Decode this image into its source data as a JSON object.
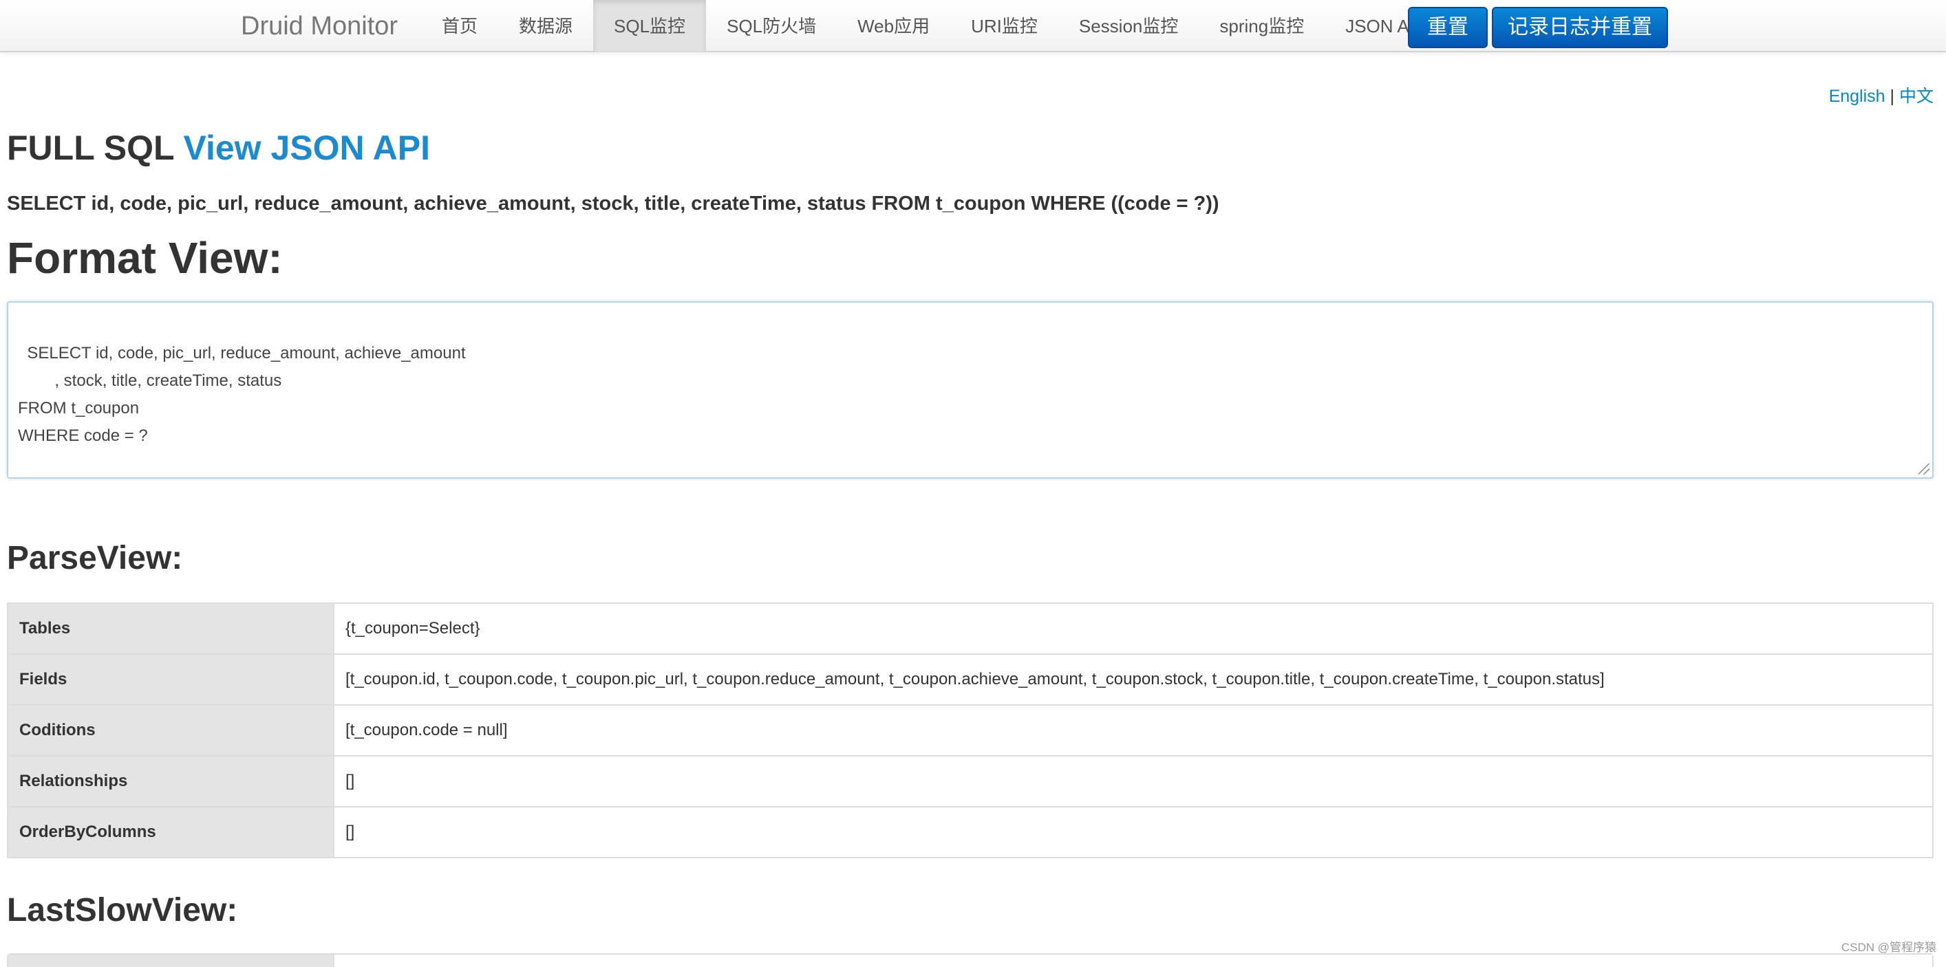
{
  "navbar": {
    "brand": "Druid Monitor",
    "items": [
      {
        "label": "首页"
      },
      {
        "label": "数据源"
      },
      {
        "label": "SQL监控"
      },
      {
        "label": "SQL防火墙"
      },
      {
        "label": "Web应用"
      },
      {
        "label": "URI监控"
      },
      {
        "label": "Session监控"
      },
      {
        "label": "spring监控"
      },
      {
        "label": "JSON API"
      }
    ],
    "active_item": "SQL监控",
    "reset_button": "重置",
    "log_reset_button": "记录日志并重置"
  },
  "lang": {
    "english": "English",
    "separator": "|",
    "chinese": "中文"
  },
  "full_sql": {
    "title": "FULL SQL",
    "link": "View JSON API",
    "sql": "SELECT id, code, pic_url, reduce_amount, achieve_amount, stock, title, createTime, status FROM t_coupon WHERE ((code = ?))"
  },
  "format_view": {
    "title": "Format View:",
    "text": "SELECT id, code, pic_url, reduce_amount, achieve_amount\n\t, stock, title, createTime, status\nFROM t_coupon\nWHERE code = ?"
  },
  "parse_view": {
    "title": "ParseView:",
    "rows": [
      {
        "key": "Tables",
        "value": "{t_coupon=Select}"
      },
      {
        "key": "Fields",
        "value": "[t_coupon.id, t_coupon.code, t_coupon.pic_url, t_coupon.reduce_amount, t_coupon.achieve_amount, t_coupon.stock, t_coupon.title, t_coupon.createTime, t_coupon.status]"
      },
      {
        "key": "Coditions",
        "value": "[t_coupon.code = null]"
      },
      {
        "key": "Relationships",
        "value": "[]"
      },
      {
        "key": "OrderByColumns",
        "value": "[]"
      }
    ]
  },
  "last_slow_view": {
    "title": "LastSlowView:"
  },
  "watermark": "CSDN @管程序猿",
  "colors": {
    "link": "#1a8ad3",
    "button": "#0456b4",
    "key_cell_bg": "#e4e4e4"
  }
}
